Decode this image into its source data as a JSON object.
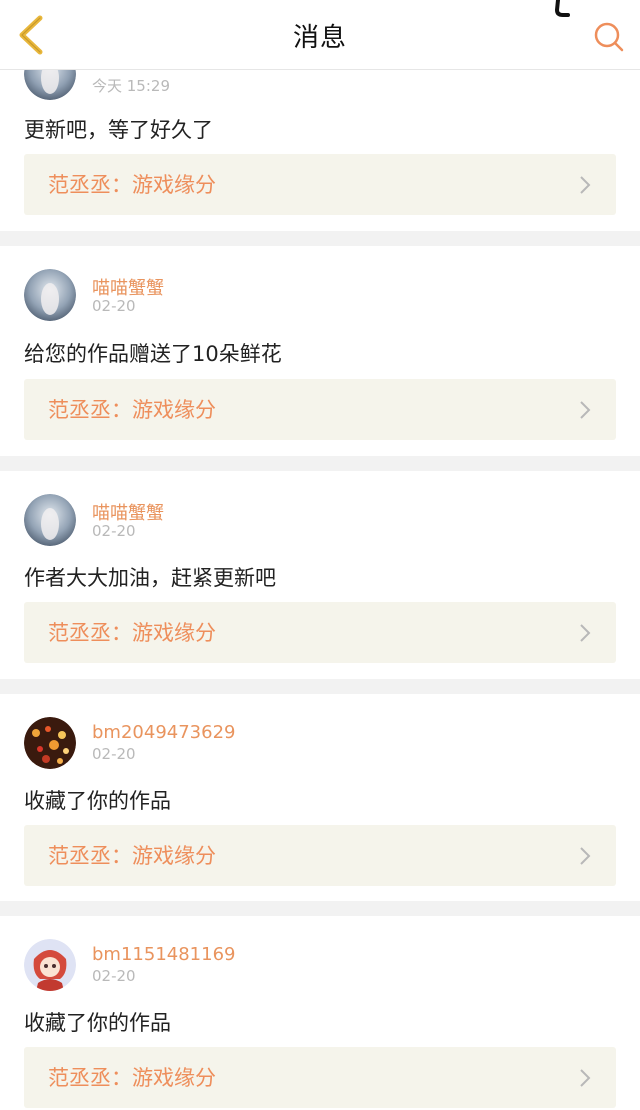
{
  "header": {
    "title": "消息",
    "back_icon": "chevron-left-icon",
    "search_icon": "search-icon",
    "accent": "#e8b73c"
  },
  "colors": {
    "username": "#e9945e",
    "link_text": "#ee8e5b",
    "link_bg": "#f5f4eb",
    "divider": "#f2f2f2"
  },
  "messages": [
    {
      "username": "",
      "date": "今天 15:29",
      "text": "更新吧，等了好久了",
      "work": "范丞丞：游戏缘分",
      "avatar": "avatar-girl-icon"
    },
    {
      "username": "喵喵蟹蟹",
      "date": "02-20",
      "text": "给您的作品赠送了10朵鲜花",
      "work": "范丞丞：游戏缘分",
      "avatar": "avatar-girl-icon"
    },
    {
      "username": "喵喵蟹蟹",
      "date": "02-20",
      "text": "作者大大加油，赶紧更新吧",
      "work": "范丞丞：游戏缘分",
      "avatar": "avatar-girl-icon"
    },
    {
      "username": "bm2049473629",
      "date": "02-20",
      "text": "收藏了你的作品",
      "work": "范丞丞：游戏缘分",
      "avatar": "avatar-lights-icon"
    },
    {
      "username": "bm1151481169",
      "date": "02-20",
      "text": "收藏了你的作品",
      "work": "范丞丞：游戏缘分",
      "avatar": "avatar-anime-icon"
    }
  ]
}
